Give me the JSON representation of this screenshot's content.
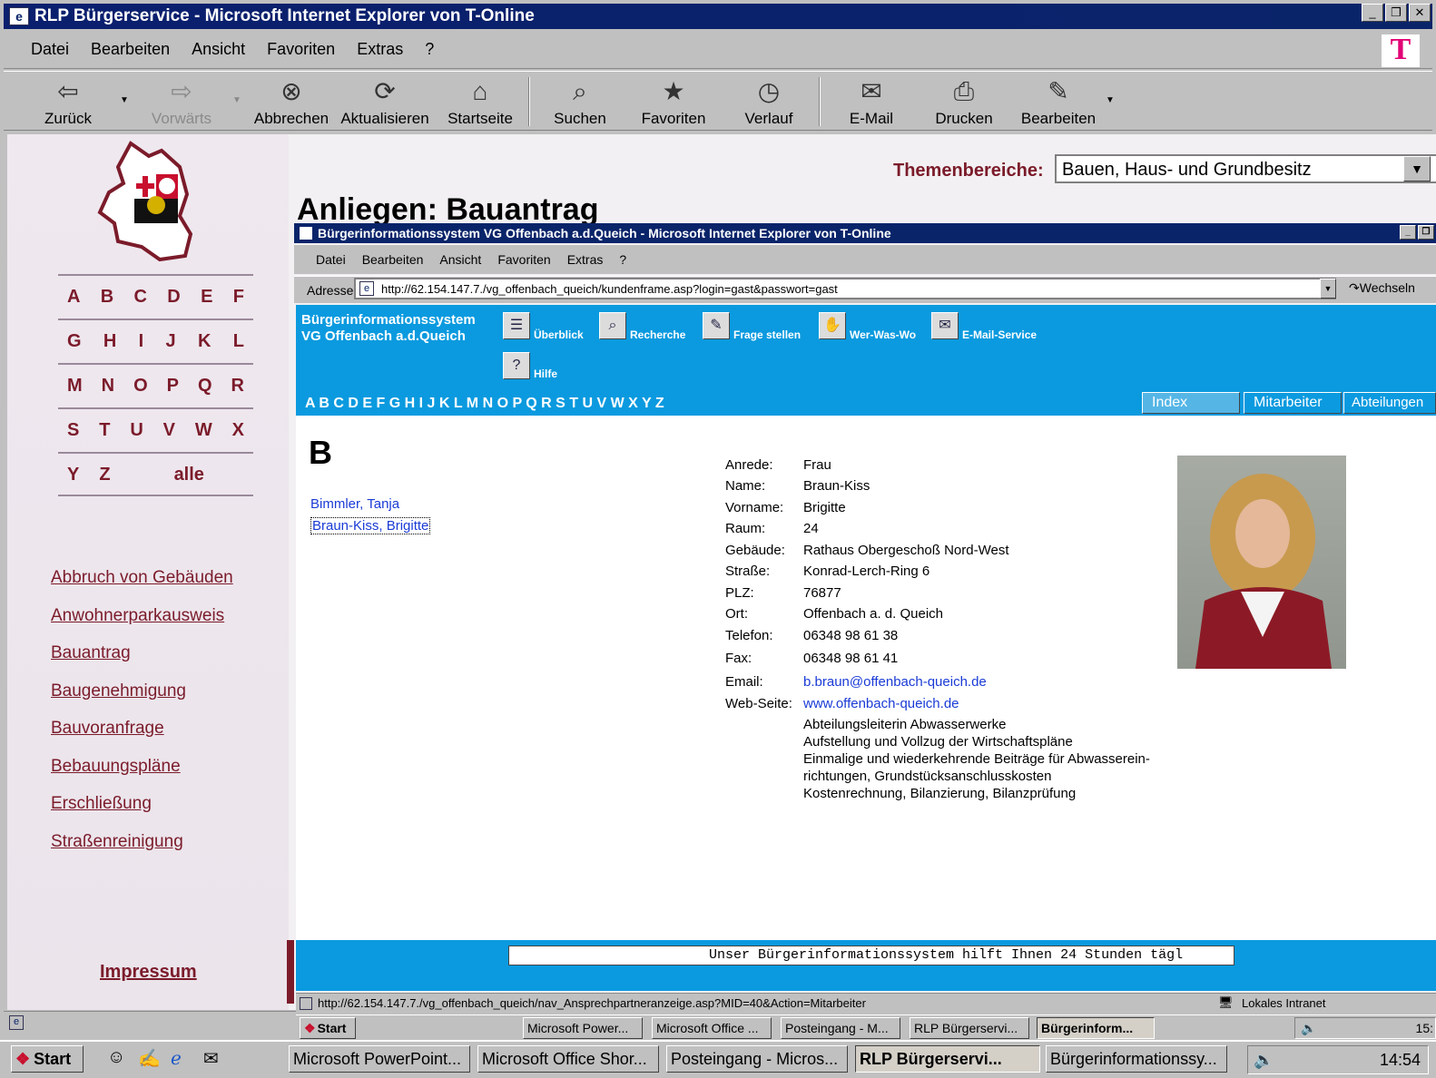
{
  "outer_window": {
    "title": "RLP Bürgerservice - Microsoft Internet Explorer von T-Online",
    "menu": [
      "Datei",
      "Bearbeiten",
      "Ansicht",
      "Favoriten",
      "Extras",
      "?"
    ],
    "toolbar": {
      "back": "Zurück",
      "forward": "Vorwärts",
      "stop": "Abbrechen",
      "refresh": "Aktualisieren",
      "home": "Startseite",
      "search": "Suchen",
      "favorites": "Favoriten",
      "history": "Verlauf",
      "mail": "E-Mail",
      "print": "Drucken",
      "edit": "Bearbeiten"
    },
    "brand_letter": "T"
  },
  "left_panel": {
    "alphabet_rows": [
      [
        "A",
        "B",
        "C",
        "D",
        "E",
        "F"
      ],
      [
        "G",
        "H",
        "I",
        "J",
        "K",
        "L"
      ],
      [
        "M",
        "N",
        "O",
        "P",
        "Q",
        "R"
      ],
      [
        "S",
        "T",
        "U",
        "V",
        "W",
        "X"
      ],
      [
        "Y",
        "Z",
        "alle"
      ]
    ],
    "links": [
      "Abbruch von Gebäuden",
      "Anwohnerparkausweis",
      "Bauantrag",
      "Baugenehmigung",
      "Bauvoranfrage",
      "Bebauungspläne",
      "Erschließung",
      "Straßenreinigung"
    ],
    "impressum": "Impressum"
  },
  "page": {
    "themen_label": "Themenbereiche:",
    "themen_value": "Bauen, Haus- und Grundbesitz",
    "heading": "Anliegen: Bauantrag"
  },
  "inner_window": {
    "title": "Bürgerinformationssystem VG Offenbach a.d.Queich - Microsoft Internet Explorer von T-Online",
    "menu": [
      "Datei",
      "Bearbeiten",
      "Ansicht",
      "Favoriten",
      "Extras",
      "?"
    ],
    "address_label": "Adresse",
    "address_url": "http://62.154.147.7./vg_offenbach_queich/kundenframe.asp?login=gast&passwort=gast",
    "go_label": "Wechseln",
    "site_title_1": "Bürgerinformationssystem",
    "site_title_2": "VG Offenbach a.d.Queich",
    "nav": {
      "overview": "Überblick",
      "research": "Recherche",
      "ask": "Frage stellen",
      "who": "Wer-Was-Wo",
      "mail": "E-Mail-Service",
      "help": "Hilfe"
    },
    "letters": "A B C D E F G H I J K L M N O P Q R S T U V W X Y Z",
    "tabs": [
      "Index",
      "Mitarbeiter",
      "Abteilungen"
    ],
    "section_letter": "B",
    "people": [
      "Bimmler, Tanja",
      "Braun-Kiss, Brigitte"
    ],
    "detail": {
      "labels": [
        "Anrede:",
        "Name:",
        "Vorname:",
        "Raum:",
        "Gebäude:",
        "Straße:",
        "PLZ:",
        "Ort:",
        "Telefon:",
        "Fax:",
        "Email:",
        "Web-Seite:"
      ],
      "values": [
        "Frau",
        "Braun-Kiss",
        "Brigitte",
        "24",
        "Rathaus Obergeschoß Nord-West",
        "Konrad-Lerch-Ring 6",
        "76877",
        "Offenbach a. d. Queich",
        "06348 98 61 38",
        "06348 98 61 41",
        "b.braun@offenbach-queich.de",
        "www.offenbach-queich.de"
      ],
      "description": [
        "Abteilungsleiterin Abwasserwerke",
        "Aufstellung und Vollzug der Wirtschaftspläne",
        "Einmalige und wiederkehrende Beiträge für Abwasserein-",
        "richtungen, Grundstücksanschlusskosten",
        "Kostenrechnung, Bilanzierung, Bilanzprüfung"
      ]
    },
    "ticker": "Unser Bürgerinformationssystem hilft Ihnen 24 Stunden tägl",
    "status_url": "http://62.154.147.7./vg_offenbach_queich/nav_Ansprechpartneranzeige.asp?MID=40&Action=Mitarbeiter",
    "status_zone": "Lokales Intranet",
    "taskbar": {
      "start": "Start",
      "buttons": [
        "Microsoft Power...",
        "Microsoft Office ...",
        "Posteingang - M...",
        "RLP Bürgerservi...",
        "Bürgerinform..."
      ],
      "clock": "15:"
    }
  },
  "taskbar": {
    "start": "Start",
    "buttons": [
      "Microsoft PowerPoint...",
      "Microsoft Office Shor...",
      "Posteingang - Micros...",
      "RLP Bürgerservi...",
      "Bürgerinformationssy..."
    ],
    "clock": "14:54"
  },
  "colors": {
    "accent_blue": "#0b9adf",
    "brand_red": "#7b1b2a",
    "title_blue": "#0a246a",
    "link_blue": "#1a3bd6"
  }
}
